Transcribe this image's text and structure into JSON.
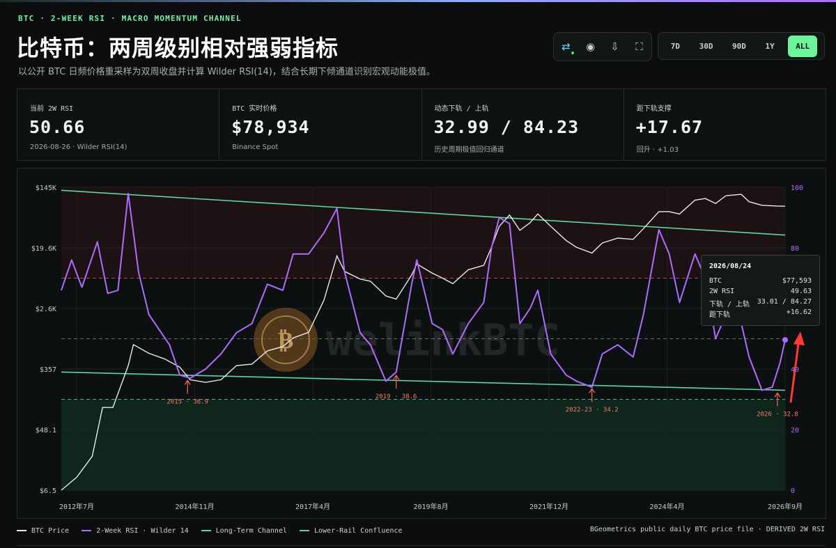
{
  "header": {
    "eyebrow": "BTC · 2-WEEK RSI · MACRO MOMENTUM CHANNEL",
    "title": "比特币：两周级别相对强弱指标",
    "subtitle": "以公开 BTC 日频价格重采样为双周收盘并计算 Wilder RSI(14)，结合长期下倾通道识别宏观动能极值。"
  },
  "toolbar": {
    "icons": [
      "swap-icon",
      "record-icon",
      "download-icon",
      "fullscreen-icon"
    ],
    "ranges": [
      "7D",
      "30D",
      "90D",
      "1Y",
      "ALL"
    ],
    "active_range": "ALL"
  },
  "stats": [
    {
      "label": "当前 2W RSI",
      "value": "50.66",
      "note": "2026-08-26 · Wilder RSI(14)"
    },
    {
      "label": "BTC 实时价格",
      "value": "$78,934",
      "note": "Binance Spot"
    },
    {
      "label": "动态下轨 / 上轨",
      "value": "32.99 / 84.23",
      "note": "历史周期极值回归通道"
    },
    {
      "label": "距下轨支撑",
      "value": "+17.67",
      "note": "回升 · +1.03"
    }
  ],
  "chart_data": {
    "type": "line",
    "x_ticks": [
      "2012年7月",
      "2014年11月",
      "2017年4月",
      "2019年8月",
      "2021年12月",
      "2024年4月",
      "2026年9月"
    ],
    "y_left_ticks": [
      "$145K",
      "$19.6K",
      "$2.6K",
      "$357",
      "$48.1",
      "$6.5"
    ],
    "y_left_scale": "log",
    "y_right_ticks": [
      "100",
      "80",
      "60",
      "40",
      "20",
      "0"
    ],
    "y_right_range": [
      0,
      100
    ],
    "series": [
      {
        "name": "BTC Price",
        "color": "#e9ecea",
        "points": [
          [
            2012.6,
            6.5
          ],
          [
            2012.9,
            10
          ],
          [
            2013.2,
            20
          ],
          [
            2013.4,
            100
          ],
          [
            2013.6,
            100
          ],
          [
            2013.9,
            400
          ],
          [
            2014.0,
            800
          ],
          [
            2014.3,
            600
          ],
          [
            2014.6,
            500
          ],
          [
            2014.9,
            380
          ],
          [
            2015.1,
            250
          ],
          [
            2015.4,
            230
          ],
          [
            2015.7,
            250
          ],
          [
            2016.0,
            400
          ],
          [
            2016.3,
            420
          ],
          [
            2016.6,
            650
          ],
          [
            2016.9,
            750
          ],
          [
            2017.1,
            1000
          ],
          [
            2017.4,
            1200
          ],
          [
            2017.7,
            3500
          ],
          [
            2017.95,
            15000
          ],
          [
            2018.1,
            9000
          ],
          [
            2018.4,
            7000
          ],
          [
            2018.6,
            6500
          ],
          [
            2018.9,
            4000
          ],
          [
            2019.1,
            3600
          ],
          [
            2019.4,
            8000
          ],
          [
            2019.5,
            11500
          ],
          [
            2019.8,
            8500
          ],
          [
            2020.0,
            7200
          ],
          [
            2020.2,
            6000
          ],
          [
            2020.5,
            9500
          ],
          [
            2020.8,
            11000
          ],
          [
            2020.95,
            20000
          ],
          [
            2021.1,
            40000
          ],
          [
            2021.3,
            58000
          ],
          [
            2021.5,
            35000
          ],
          [
            2021.7,
            45000
          ],
          [
            2021.85,
            60000
          ],
          [
            2022.1,
            40000
          ],
          [
            2022.4,
            25000
          ],
          [
            2022.6,
            20000
          ],
          [
            2022.9,
            16500
          ],
          [
            2023.1,
            23000
          ],
          [
            2023.4,
            27000
          ],
          [
            2023.7,
            26000
          ],
          [
            2023.9,
            37000
          ],
          [
            2024.2,
            65000
          ],
          [
            2024.4,
            65000
          ],
          [
            2024.6,
            60000
          ],
          [
            2024.9,
            95000
          ],
          [
            2025.1,
            100000
          ],
          [
            2025.3,
            85000
          ],
          [
            2025.5,
            110000
          ],
          [
            2025.8,
            115000
          ],
          [
            2025.95,
            90000
          ],
          [
            2026.2,
            80000
          ],
          [
            2026.5,
            78000
          ],
          [
            2026.65,
            77593
          ]
        ]
      },
      {
        "name": "2-Week RSI · Wilder 14",
        "color": "#b06cff",
        "points": [
          [
            2012.6,
            66
          ],
          [
            2012.8,
            76
          ],
          [
            2013.0,
            67
          ],
          [
            2013.3,
            82
          ],
          [
            2013.5,
            65
          ],
          [
            2013.7,
            66
          ],
          [
            2013.9,
            98
          ],
          [
            2014.1,
            72
          ],
          [
            2014.3,
            58
          ],
          [
            2014.5,
            53
          ],
          [
            2014.7,
            48
          ],
          [
            2014.9,
            38
          ],
          [
            2015.1,
            37
          ],
          [
            2015.4,
            40
          ],
          [
            2015.7,
            45
          ],
          [
            2016.0,
            52
          ],
          [
            2016.3,
            55
          ],
          [
            2016.6,
            68
          ],
          [
            2016.9,
            66
          ],
          [
            2017.1,
            78
          ],
          [
            2017.4,
            78
          ],
          [
            2017.7,
            85
          ],
          [
            2017.95,
            93
          ],
          [
            2018.1,
            72
          ],
          [
            2018.4,
            52
          ],
          [
            2018.6,
            48
          ],
          [
            2018.9,
            36
          ],
          [
            2019.1,
            39
          ],
          [
            2019.4,
            68
          ],
          [
            2019.5,
            76
          ],
          [
            2019.8,
            55
          ],
          [
            2020.0,
            53
          ],
          [
            2020.2,
            45
          ],
          [
            2020.5,
            55
          ],
          [
            2020.8,
            62
          ],
          [
            2020.95,
            80
          ],
          [
            2021.1,
            90
          ],
          [
            2021.3,
            88
          ],
          [
            2021.5,
            55
          ],
          [
            2021.7,
            60
          ],
          [
            2021.85,
            66
          ],
          [
            2022.1,
            45
          ],
          [
            2022.4,
            38
          ],
          [
            2022.6,
            36
          ],
          [
            2022.9,
            34
          ],
          [
            2023.1,
            45
          ],
          [
            2023.4,
            48
          ],
          [
            2023.7,
            44
          ],
          [
            2023.9,
            58
          ],
          [
            2024.2,
            86
          ],
          [
            2024.4,
            78
          ],
          [
            2024.6,
            62
          ],
          [
            2024.9,
            78
          ],
          [
            2025.1,
            70
          ],
          [
            2025.3,
            50
          ],
          [
            2025.5,
            58
          ],
          [
            2025.8,
            55
          ],
          [
            2025.95,
            44
          ],
          [
            2026.2,
            33
          ],
          [
            2026.4,
            34
          ],
          [
            2026.55,
            42
          ],
          [
            2026.65,
            49.63
          ]
        ]
      },
      {
        "name": "Long-Term Channel",
        "color": "#5fd6a5",
        "segments": [
          [
            [
              2012.6,
              99
            ],
            [
              2026.65,
              84.23
            ]
          ],
          [
            [
              2012.6,
              39
            ],
            [
              2026.65,
              33.01
            ]
          ]
        ]
      },
      {
        "name": "Lower-Rail Confluence",
        "color": "#5fd6a5"
      }
    ],
    "reference_lines": [
      {
        "value": 70,
        "color": "#e05a5a"
      },
      {
        "value": 50,
        "color": "#7d8582"
      },
      {
        "value": 30,
        "color": "#5fd6a5"
      }
    ],
    "annotations": [
      {
        "text": "2015 · 36.9",
        "x": 2015.05,
        "y": 36.9
      },
      {
        "text": "2019 · 38.6",
        "x": 2019.1,
        "y": 38.6
      },
      {
        "text": "2022-23 · 34.2",
        "x": 2022.9,
        "y": 34.2
      },
      {
        "text": "2026 · 32.8",
        "x": 2026.5,
        "y": 32.8
      }
    ],
    "watermark": "welinkBTC",
    "x_range": [
      2012.6,
      2026.65
    ]
  },
  "tooltip": {
    "date": "2026/08/24",
    "rows": [
      {
        "label": "BTC",
        "value": "$77,593"
      },
      {
        "label": "2W RSI",
        "value": "49.63"
      },
      {
        "label": "下轨 / 上轨",
        "value": "33.01 / 84.27"
      },
      {
        "label": "距下轨",
        "value": "+16.62"
      }
    ]
  },
  "legend": {
    "items": [
      {
        "label": "BTC Price",
        "color": "#e9ecea"
      },
      {
        "label": "2-Week RSI · Wilder 14",
        "color": "#b06cff"
      },
      {
        "label": "Long-Term Channel",
        "color": "#5fd6a5"
      },
      {
        "label": "Lower-Rail Confluence",
        "color": "#5fd6a5"
      }
    ],
    "source": "BGeometrics public daily BTC price file · DERIVED 2W RSI"
  }
}
